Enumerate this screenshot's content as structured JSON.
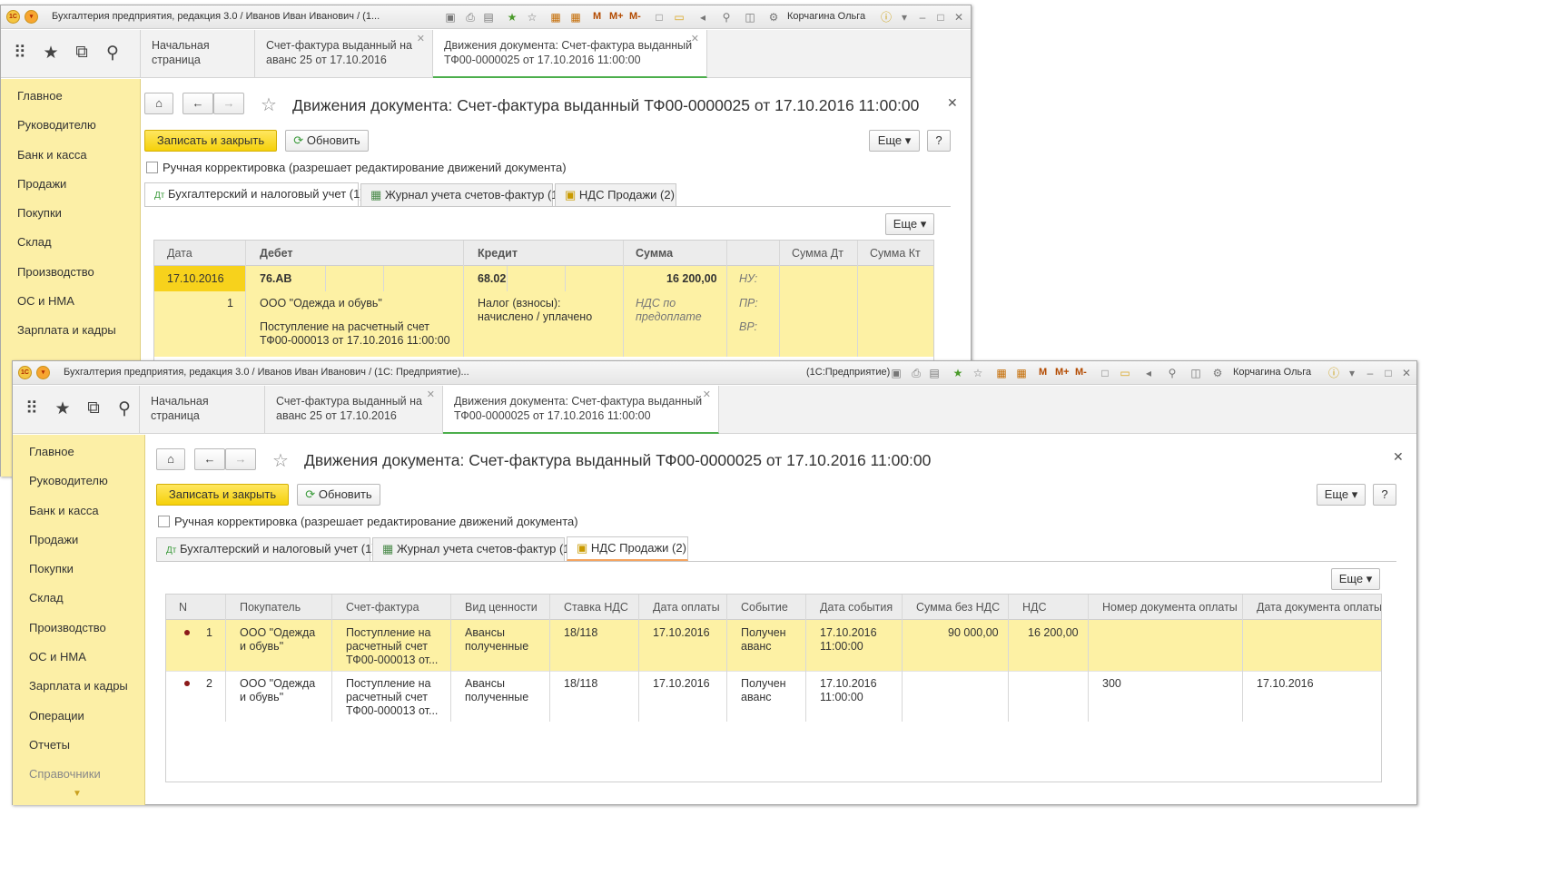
{
  "window1": {
    "title": "Бухгалтерия предприятия, редакция 3.0 / Иванов Иван Иванович / (1...",
    "user": "Корчагина Ольга",
    "m_labels": [
      "M",
      "M+",
      "M-"
    ]
  },
  "window2": {
    "title": "Бухгалтерия предприятия, редакция 3.0 / Иванов Иван Иванович / (1С: Предприятие)...",
    "title_right": "(1С:Предприятие)",
    "user": "Корчагина Ольга",
    "m_labels": [
      "M",
      "M+",
      "M-"
    ]
  },
  "tabs": {
    "home": "Начальная страница",
    "invoice_1": "Счет-фактура выданный на",
    "invoice_2": "аванс 25 от 17.10.2016",
    "movements_1": "Движения документа: Счет-фактура выданный",
    "movements_2": "ТФ00-0000025 от 17.10.2016 11:00:00"
  },
  "sidebar": {
    "items": [
      "Главное",
      "Руководителю",
      "Банк и касса",
      "Продажи",
      "Покупки",
      "Склад",
      "Производство",
      "ОС и НМА",
      "Зарплата и кадры",
      "Операции",
      "Отчеты",
      "Справочники"
    ]
  },
  "form": {
    "title": "Движения документа: Счет-фактура выданный ТФ00-0000025 от 17.10.2016 11:00:00",
    "save_close": "Записать и закрыть",
    "refresh": "Обновить",
    "more": "Еще",
    "help": "?",
    "manual_edit": "Ручная корректировка (разрешает редактирование движений документа)",
    "doc_tabs": [
      "Бухгалтерский и налоговый учет (1)",
      "Журнал учета счетов-фактур (1)",
      "НДС Продажи (2)"
    ]
  },
  "ledger": {
    "headers": [
      "Дата",
      "Дебет",
      "Кредит",
      "Сумма",
      "",
      "Сумма Дт",
      "Сумма Кт"
    ],
    "row": {
      "date": "17.10.2016",
      "number": "1",
      "debit_account": "76.АВ",
      "debit_sub1": "ООО \"Одежда и обувь\"",
      "debit_sub2_a": "Поступление на расчетный счет",
      "debit_sub2_b": "ТФ00-000013 от 17.10.2016 11:00:00",
      "credit_account": "68.02",
      "credit_sub1_a": "Налог (взносы):",
      "credit_sub1_b": "начислено / уплачено",
      "amount": "16 200,00",
      "amount_note_a": "НДС по",
      "amount_note_b": "предоплате",
      "nu": "НУ:",
      "pr": "ПР:",
      "vr": "ВР:"
    }
  },
  "vat_sales": {
    "headers": [
      "N",
      "Покупатель",
      "Счет-фактура",
      "Вид ценности",
      "Ставка НДС",
      "Дата оплаты",
      "Событие",
      "Дата события",
      "Сумма без НДС",
      "НДС",
      "Номер документа оплаты",
      "Дата документа оплаты"
    ],
    "rows": [
      {
        "n": "1",
        "buyer_a": "ООО \"Одежда",
        "buyer_b": "и обувь\"",
        "inv_a": "Поступление на",
        "inv_b": "расчетный счет",
        "inv_c": "ТФ00-000013 от...",
        "kind_a": "Авансы",
        "kind_b": "полученные",
        "rate": "18/118",
        "pay_date": "17.10.2016",
        "event_a": "Получен",
        "event_b": "аванс",
        "ev_date_a": "17.10.2016",
        "ev_date_b": "11:00:00",
        "net": "90 000,00",
        "vat": "16 200,00",
        "pay_doc": "",
        "pay_doc_date": ""
      },
      {
        "n": "2",
        "buyer_a": "ООО \"Одежда",
        "buyer_b": "и обувь\"",
        "inv_a": "Поступление на",
        "inv_b": "расчетный счет",
        "inv_c": "ТФ00-000013 от...",
        "kind_a": "Авансы",
        "kind_b": "полученные",
        "rate": "18/118",
        "pay_date": "17.10.2016",
        "event_a": "Получен",
        "event_b": "аванс",
        "ev_date_a": "17.10.2016",
        "ev_date_b": "11:00:00",
        "net": "",
        "vat": "",
        "pay_doc": "300",
        "pay_doc_date": "17.10.2016"
      }
    ]
  }
}
